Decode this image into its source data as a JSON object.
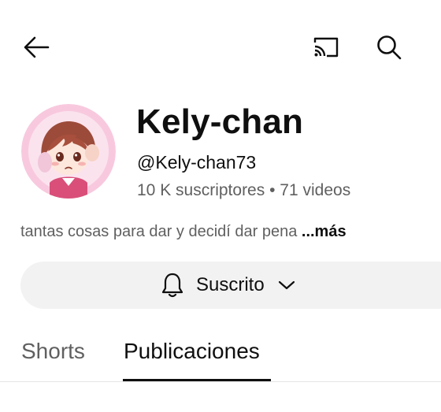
{
  "topbar": {
    "back_icon": "arrow-left-icon",
    "cast_icon": "cast-icon",
    "search_icon": "search-icon"
  },
  "channel": {
    "name": "Kely-chan",
    "handle": "@Kely-chan73",
    "subscribers": "10 K suscriptores",
    "separator": "•",
    "videos": "71 videos",
    "description": "tantas cosas para dar y decidí dar pena",
    "more_label": "...más",
    "avatar_ring_color": "#f8c9de"
  },
  "subscribe_button": {
    "label": "Suscrito",
    "bell_icon": "bell-icon",
    "chevron_icon": "chevron-down-icon"
  },
  "tabs": [
    {
      "label": "Shorts",
      "active": false
    },
    {
      "label": "Publicaciones",
      "active": true
    }
  ],
  "colors": {
    "primary_text": "#0f0f0f",
    "secondary_text": "#606060",
    "pill_background": "#f2f2f2"
  }
}
